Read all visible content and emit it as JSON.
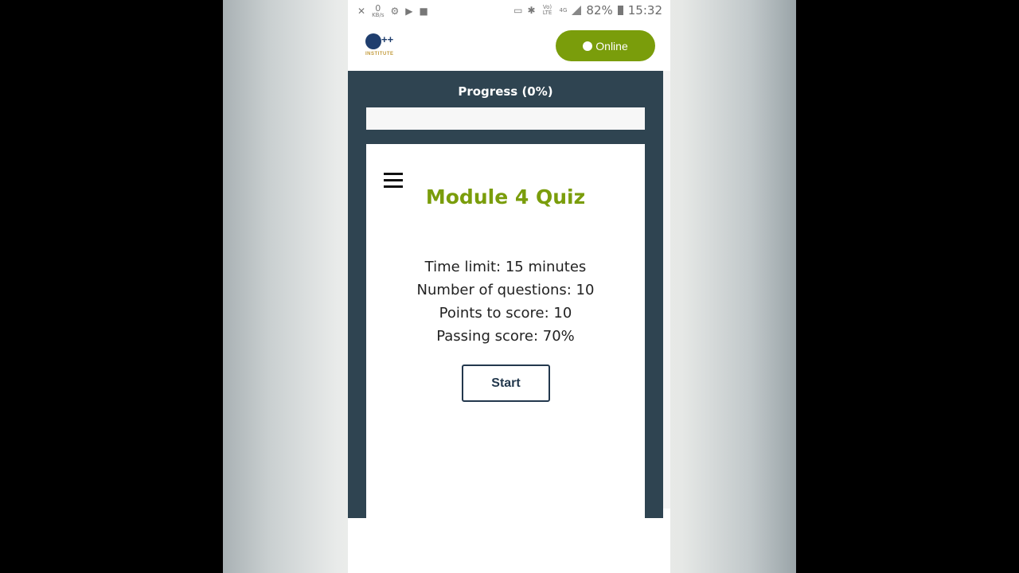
{
  "status_bar": {
    "kb_value": "0",
    "kb_unit": "KB/s",
    "battery_percent": "82%",
    "time": "15:32",
    "network": "4G",
    "volte": "Vo) LTE"
  },
  "header": {
    "logo_plus": "++",
    "logo_text": "INSTITUTE",
    "online_label": "Online"
  },
  "progress": {
    "label": "Progress (0%)",
    "value": 0
  },
  "quiz": {
    "title": "Module 4 Quiz",
    "time_limit": "Time limit: 15 minutes",
    "num_questions": "Number of questions: 10",
    "points": "Points to score: 10",
    "passing": "Passing score: 70%",
    "start_label": "Start"
  },
  "colors": {
    "accent": "#7a9d0b",
    "dark_panel": "#2f4451",
    "button_border": "#23384d"
  }
}
